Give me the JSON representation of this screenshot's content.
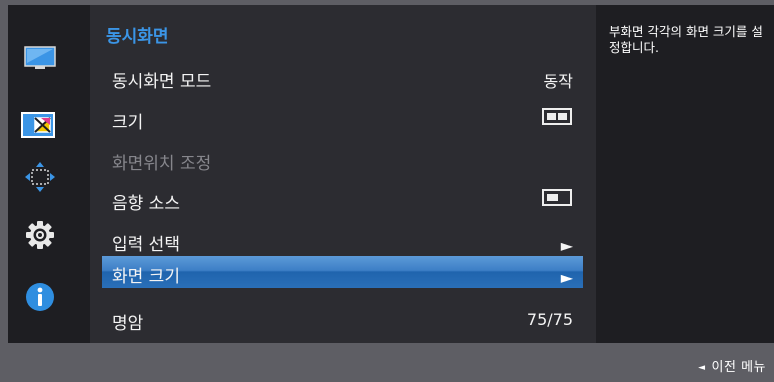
{
  "colors": {
    "accent": "#3b95e6",
    "selected_bg": "#2a6fb8",
    "panel_bg": "#2c2c31",
    "sidebar_bg": "#1e1e22",
    "bottom_bar_bg": "#5e5e64",
    "disabled_text": "#86868c"
  },
  "sidebar": {
    "icons": [
      {
        "name": "monitor-icon",
        "active": false
      },
      {
        "name": "picture-in-picture-icon",
        "active": true
      },
      {
        "name": "position-arrows-icon",
        "active": false
      },
      {
        "name": "gear-icon",
        "active": false
      },
      {
        "name": "info-icon",
        "active": false
      }
    ]
  },
  "menu": {
    "title": "동시화면",
    "items": [
      {
        "label": "동시화면 모드",
        "value": "동작",
        "state": "normal"
      },
      {
        "label": "크기",
        "value_icon": "size-large-split-icon",
        "state": "normal"
      },
      {
        "label": "화면위치 조정",
        "state": "disabled"
      },
      {
        "label": "음향 소스",
        "value_icon": "sound-source-icon",
        "state": "normal"
      },
      {
        "label": "입력 선택",
        "value_icon": "submenu-arrow-icon",
        "state": "normal"
      },
      {
        "label": "화면 크기",
        "value_icon": "submenu-arrow-icon",
        "state": "selected"
      },
      {
        "label": "명암",
        "value": "75/75",
        "state": "normal"
      }
    ]
  },
  "help": {
    "text": "부화면 각각의 화면 크기를 설정합니다."
  },
  "footer": {
    "back_label": "이전 메뉴",
    "back_icon": "◄"
  }
}
